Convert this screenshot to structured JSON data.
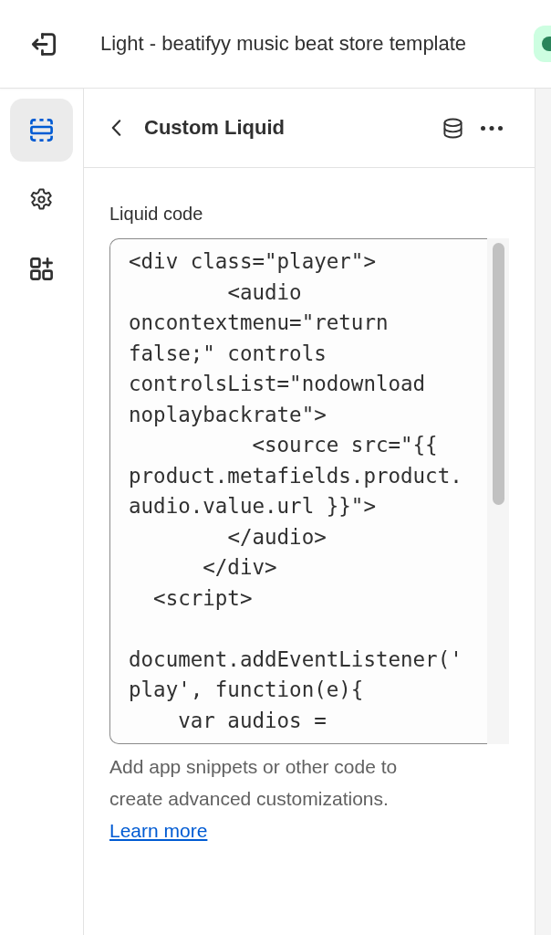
{
  "top_bar": {
    "theme_name": "Light - beatifyy music beat store template"
  },
  "sidebar": {
    "items": [
      {
        "kind": "sections",
        "selected": true
      },
      {
        "kind": "settings",
        "selected": false
      },
      {
        "kind": "apps",
        "selected": false
      }
    ]
  },
  "panel": {
    "title": "Custom Liquid",
    "field": {
      "label": "Liquid code",
      "value": "<div class=\"player\">\n        <audio oncontextmenu=\"return false;\" controls controlsList=\"nodownload noplaybackrate\">\n          <source src=\"{{ product.metafields.product.audio.value.url }}\">\n        </audio>\n      </div>\n  <script>\n\ndocument.addEventListener('play', function(e){\n    var audios =",
      "help_text": "Add app snippets or other code to create advanced customizations.",
      "link": "Learn more"
    }
  }
}
